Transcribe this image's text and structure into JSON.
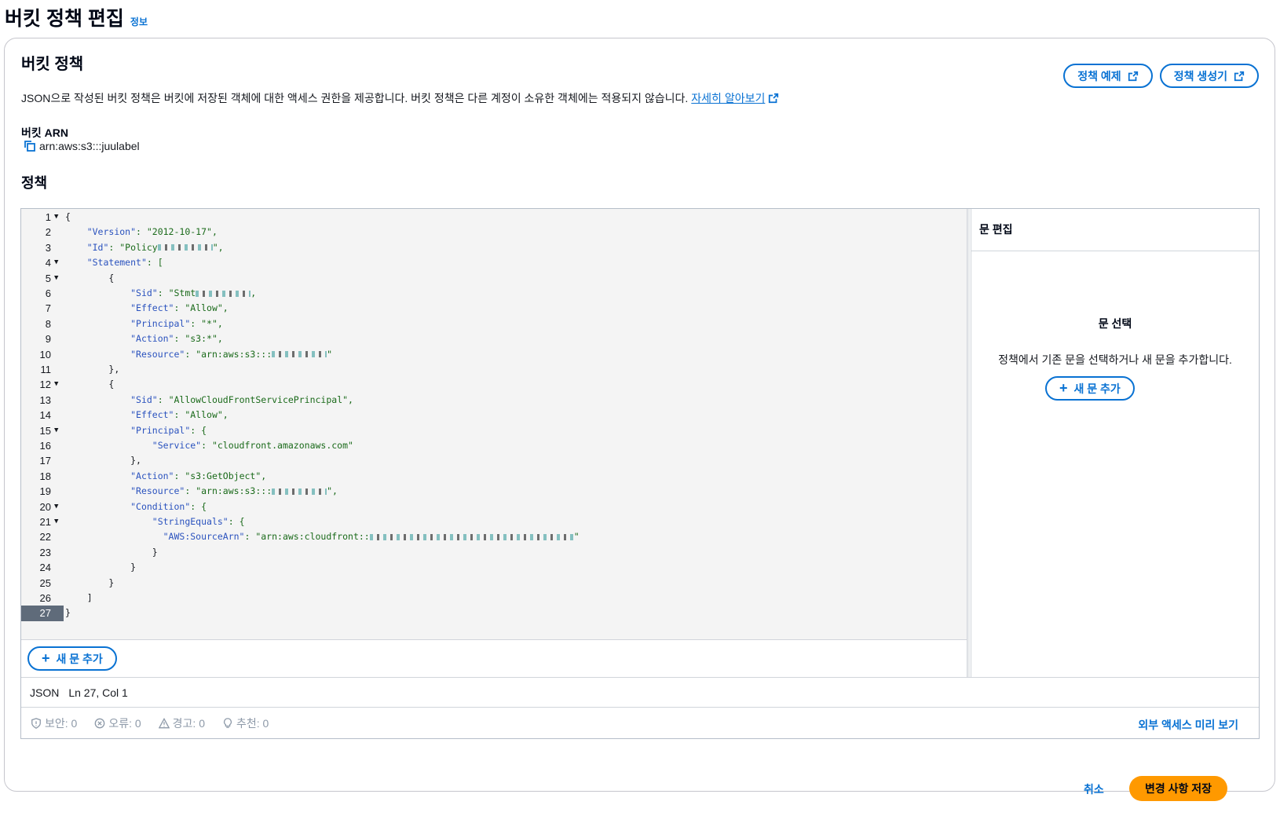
{
  "page": {
    "title": "버킷 정책 편집",
    "info_link": "정보"
  },
  "section": {
    "title": "버킷 정책",
    "description": "JSON으로 작성된 버킷 정책은 버킷에 저장된 객체에 대한 액세스 권한을 제공합니다. 버킷 정책은 다른 계정이 소유한 객체에는 적용되지 않습니다.",
    "learn_more": "자세히 알아보기",
    "policy_examples_button": "정책 예제",
    "policy_generator_button": "정책 생성기"
  },
  "arn": {
    "label": "버킷 ARN",
    "value": "arn:aws:s3:::juulabel"
  },
  "policy": {
    "label": "정책",
    "line_numbers": [
      "1",
      "2",
      "3",
      "4",
      "5",
      "6",
      "7",
      "8",
      "9",
      "10",
      "11",
      "12",
      "13",
      "14",
      "15",
      "16",
      "17",
      "18",
      "19",
      "20",
      "21",
      "22",
      "23",
      "24",
      "25",
      "26",
      "27"
    ],
    "active_line": 27,
    "foldable_lines": [
      1,
      4,
      5,
      12,
      15,
      20,
      21
    ],
    "lines": [
      {
        "indent": "",
        "key": "",
        "rest": "{"
      },
      {
        "indent": "    ",
        "key": "\"Version\"",
        "rest": ": \"2012-10-17\","
      },
      {
        "indent": "    ",
        "key": "\"Id\"",
        "rest": ": \"Policy",
        "redacted": true,
        "tail": "\","
      },
      {
        "indent": "    ",
        "key": "\"Statement\"",
        "rest": ": ["
      },
      {
        "indent": "        ",
        "key": "",
        "rest": "{"
      },
      {
        "indent": "            ",
        "key": "\"Sid\"",
        "rest": ": \"Stmt",
        "redacted": true,
        "tail": ","
      },
      {
        "indent": "            ",
        "key": "\"Effect\"",
        "rest": ": \"Allow\","
      },
      {
        "indent": "            ",
        "key": "\"Principal\"",
        "rest": ": \"*\","
      },
      {
        "indent": "            ",
        "key": "\"Action\"",
        "rest": ": \"s3:*\","
      },
      {
        "indent": "            ",
        "key": "\"Resource\"",
        "rest": ": \"arn:aws:s3:::",
        "redacted": true,
        "tail": "\""
      },
      {
        "indent": "        ",
        "key": "",
        "rest": "},"
      },
      {
        "indent": "        ",
        "key": "",
        "rest": "{"
      },
      {
        "indent": "            ",
        "key": "\"Sid\"",
        "rest": ": \"AllowCloudFrontServicePrincipal\","
      },
      {
        "indent": "            ",
        "key": "\"Effect\"",
        "rest": ": \"Allow\","
      },
      {
        "indent": "            ",
        "key": "\"Principal\"",
        "rest": ": {"
      },
      {
        "indent": "                ",
        "key": "\"Service\"",
        "rest": ": \"cloudfront.amazonaws.com\""
      },
      {
        "indent": "            ",
        "key": "",
        "rest": "},"
      },
      {
        "indent": "            ",
        "key": "\"Action\"",
        "rest": ": \"s3:GetObject\","
      },
      {
        "indent": "            ",
        "key": "\"Resource\"",
        "rest": ": \"arn:aws:s3:::",
        "redacted": true,
        "tail": "\","
      },
      {
        "indent": "            ",
        "key": "\"Condition\"",
        "rest": ": {"
      },
      {
        "indent": "                ",
        "key": "\"StringEquals\"",
        "rest": ": {"
      },
      {
        "indent": "                  ",
        "key": "\"AWS:SourceArn\"",
        "rest": ": \"arn:aws:cloudfront::",
        "redacted": true,
        "redacted_long": true,
        "tail": "\""
      },
      {
        "indent": "                ",
        "key": "",
        "rest": "}"
      },
      {
        "indent": "            ",
        "key": "",
        "rest": "}"
      },
      {
        "indent": "        ",
        "key": "",
        "rest": "}"
      },
      {
        "indent": "    ",
        "key": "",
        "rest": "]"
      },
      {
        "indent": "",
        "key": "",
        "rest": "}"
      }
    ],
    "add_statement_button": "새 문 추가"
  },
  "side_panel": {
    "title": "문 편집",
    "empty_title": "문 선택",
    "empty_description": "정책에서 기존 문을 선택하거나 새 문을 추가합니다.",
    "add_statement_button": "새 문 추가"
  },
  "status_bar": {
    "language": "JSON",
    "cursor": "Ln 27, Col 1"
  },
  "lint": {
    "security": "보안: 0",
    "errors": "오류: 0",
    "warnings": "경고: 0",
    "suggestions": "추천: 0",
    "preview_link": "외부 액세스 미리 보기"
  },
  "footer": {
    "cancel": "취소",
    "save": "변경 사항 저장"
  },
  "colors": {
    "primary": "#0972d3",
    "save_button": "#ff9900",
    "active_line_bg": "#5f6b7a",
    "json_key": "#2a52be",
    "json_string": "#1a6a1a"
  }
}
